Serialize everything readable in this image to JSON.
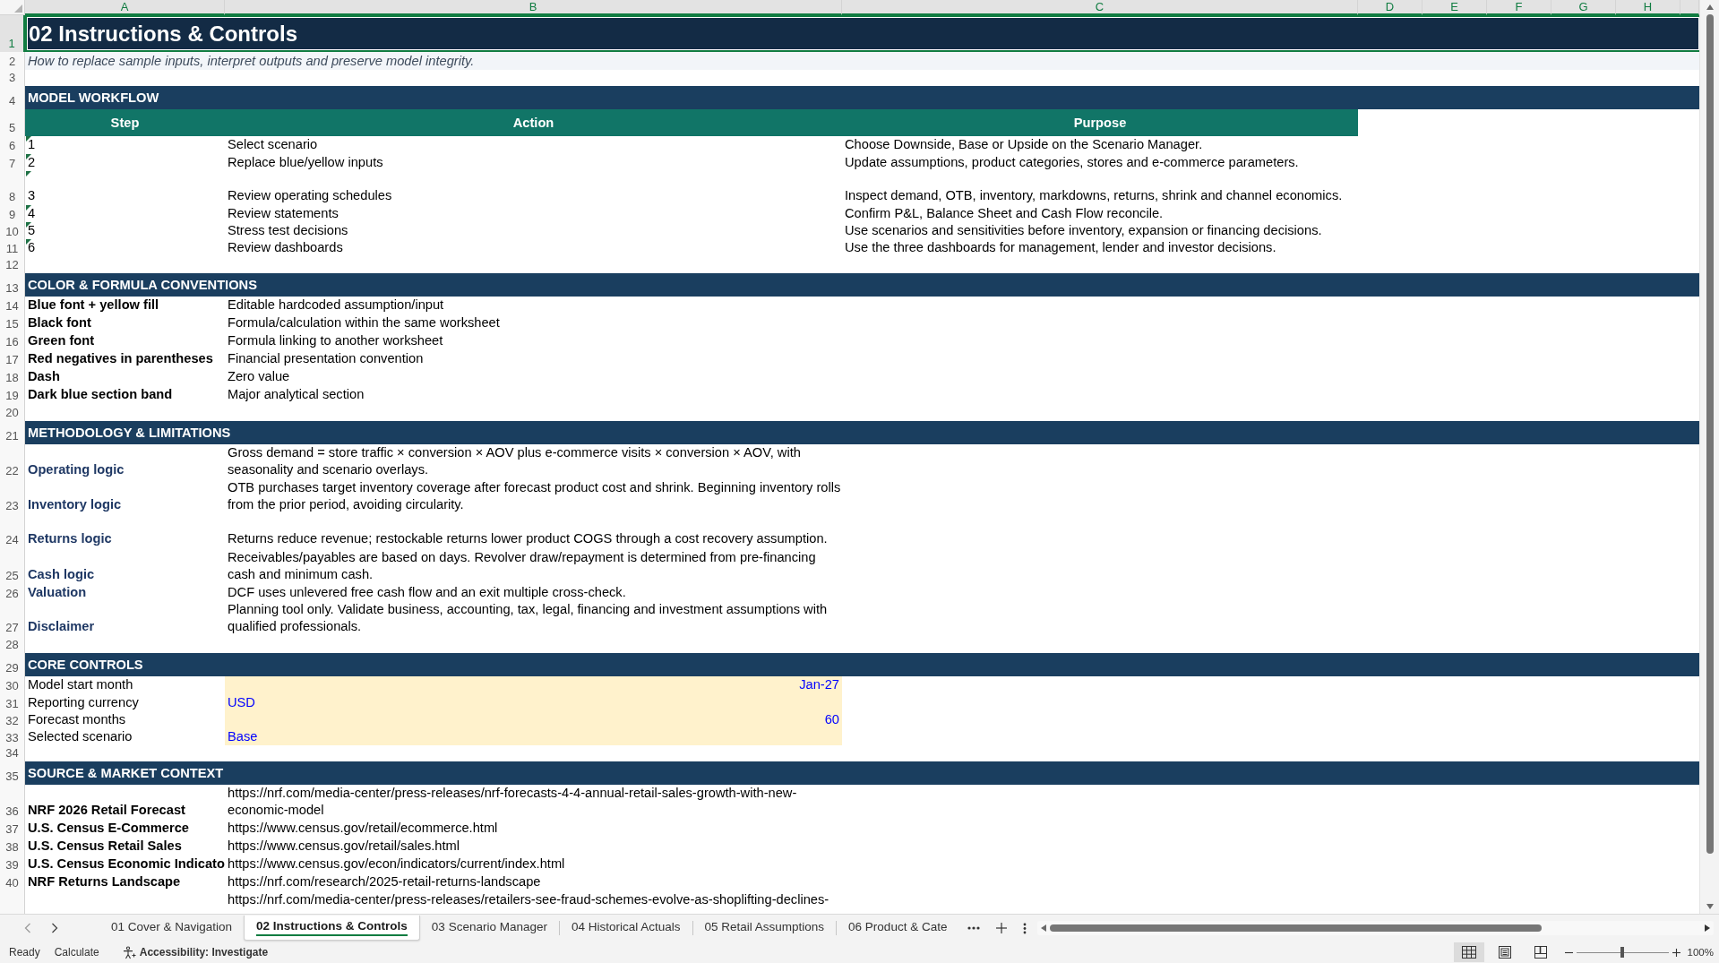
{
  "sheet": {
    "columns": [
      {
        "label": "A",
        "selected": true
      },
      {
        "label": "B",
        "selected": true
      },
      {
        "label": "C",
        "selected": true
      },
      {
        "label": "D",
        "selected": true
      },
      {
        "label": "E",
        "selected": true
      },
      {
        "label": "F",
        "selected": true
      },
      {
        "label": "G",
        "selected": true
      },
      {
        "label": "H",
        "selected": true
      }
    ],
    "rows": [
      {
        "row": "1",
        "kind": "title",
        "text": "02 Instructions & Controls",
        "selected": true
      },
      {
        "row": "2",
        "kind": "subtitle",
        "text": "How to replace sample inputs, interpret outputs and preserve model integrity."
      },
      {
        "row": "3",
        "kind": "blank"
      },
      {
        "row": "4",
        "kind": "section",
        "text": "MODEL WORKFLOW"
      },
      {
        "row": "5",
        "kind": "table_header",
        "cells": [
          "Step",
          "Action",
          "Purpose"
        ]
      },
      {
        "row": "6",
        "kind": "step",
        "flagged": true,
        "cells": [
          "1",
          "Select scenario",
          "Choose Downside, Base or Upside on the Scenario Manager."
        ]
      },
      {
        "row": "7",
        "kind": "step",
        "flagged": true,
        "cells": [
          "2",
          "Replace blue/yellow inputs",
          "Update assumptions, product categories, stores and e-commerce parameters."
        ]
      },
      {
        "row": "8",
        "kind": "step",
        "flagged": true,
        "cells": [
          "3",
          "Review operating schedules",
          "Inspect demand, OTB, inventory, markdowns, returns, shrink and channel economics."
        ]
      },
      {
        "row": "9",
        "kind": "step",
        "flagged": true,
        "cells": [
          "4",
          "Review statements",
          "Confirm P&L, Balance Sheet and Cash Flow reconcile."
        ]
      },
      {
        "row": "10",
        "kind": "step",
        "flagged": true,
        "cells": [
          "5",
          "Stress test decisions",
          "Use scenarios and sensitivities before inventory, expansion or financing decisions."
        ]
      },
      {
        "row": "11",
        "kind": "step",
        "flagged": true,
        "cells": [
          "6",
          "Review dashboards",
          "Use the three dashboards for management, lender and investor decisions."
        ]
      },
      {
        "row": "12",
        "kind": "blank"
      },
      {
        "row": "13",
        "kind": "section",
        "text": "COLOR & FORMULA CONVENTIONS"
      },
      {
        "row": "14",
        "kind": "convention",
        "label": "Blue font + yellow fill",
        "description": "Editable hardcoded assumption/input"
      },
      {
        "row": "15",
        "kind": "convention",
        "label": "Black font",
        "description": "Formula/calculation within the same worksheet"
      },
      {
        "row": "16",
        "kind": "convention",
        "label": "Green font",
        "description": "Formula linking to another worksheet"
      },
      {
        "row": "17",
        "kind": "convention",
        "label": "Red negatives in parentheses",
        "description": "Financial presentation convention"
      },
      {
        "row": "18",
        "kind": "convention",
        "label": "Dash",
        "description": "Zero value"
      },
      {
        "row": "19",
        "kind": "convention",
        "label": "Dark blue section band",
        "description": "Major analytical section"
      },
      {
        "row": "20",
        "kind": "blank"
      },
      {
        "row": "21",
        "kind": "section",
        "text": "METHODOLOGY & LIMITATIONS"
      },
      {
        "row": "22",
        "kind": "method",
        "label": "Operating logic",
        "description": "Gross demand = store traffic × conversion × AOV plus e-commerce visits × conversion × AOV, with seasonality and scenario overlays."
      },
      {
        "row": "23",
        "kind": "method",
        "label": "Inventory logic",
        "description": "OTB purchases target inventory coverage after forecast product cost and shrink. Beginning inventory rolls from the prior period, avoiding circularity."
      },
      {
        "row": "24",
        "kind": "method",
        "label": "Returns logic",
        "description": "Returns reduce revenue; restockable returns lower product COGS through a cost recovery assumption."
      },
      {
        "row": "25",
        "kind": "method",
        "label": "Cash logic",
        "description": "Receivables/payables are based on days. Revolver draw/repayment is determined from pre-financing cash and minimum cash."
      },
      {
        "row": "26",
        "kind": "method",
        "label": "Valuation",
        "description": "DCF uses unlevered free cash flow and an exit multiple cross-check."
      },
      {
        "row": "27",
        "kind": "method",
        "label": "Disclaimer",
        "description": "Planning tool only. Validate business, accounting, tax, legal, financing and investment assumptions with qualified professionals."
      },
      {
        "row": "28",
        "kind": "blank"
      },
      {
        "row": "29",
        "kind": "section",
        "text": "CORE CONTROLS"
      },
      {
        "row": "30",
        "kind": "date_input",
        "label": "Model start month",
        "value": "Jan-27"
      },
      {
        "row": "31",
        "kind": "text_input",
        "label": "Reporting currency",
        "value": "USD"
      },
      {
        "row": "32",
        "kind": "number_input",
        "label": "Forecast months",
        "value": "60"
      },
      {
        "row": "33",
        "kind": "text_input",
        "label": "Selected scenario",
        "value": "Base"
      },
      {
        "row": "34",
        "kind": "blank"
      },
      {
        "row": "35",
        "kind": "section",
        "text": "SOURCE & MARKET CONTEXT"
      },
      {
        "row": "36",
        "kind": "source",
        "label": "NRF 2026 Retail Forecast",
        "url": "https://nrf.com/media-center/press-releases/nrf-forecasts-4-4-annual-retail-sales-growth-with-new-economic-model"
      },
      {
        "row": "37",
        "kind": "source",
        "label": "U.S. Census E-Commerce",
        "url": "https://www.census.gov/retail/ecommerce.html"
      },
      {
        "row": "38",
        "kind": "source",
        "label": "U.S. Census Retail Sales",
        "url": "https://www.census.gov/retail/sales.html"
      },
      {
        "row": "39",
        "kind": "source",
        "label": "U.S. Census Economic Indicato",
        "url": "https://www.census.gov/econ/indicators/current/index.html"
      },
      {
        "row": "40",
        "kind": "source",
        "label": "NRF Returns Landscape",
        "url": "https://nrf.com/research/2025-retail-returns-landscape"
      },
      {
        "kind": "source",
        "url": "https://nrf.com/media-center/press-releases/retailers-see-fraud-schemes-evolve-as-shoplifting-declines-"
      }
    ]
  },
  "sheet_tabs": [
    {
      "label": "01 Cover & Navigation",
      "selected": false
    },
    {
      "label": "02 Instructions & Controls",
      "selected": true
    },
    {
      "label": "03 Scenario Manager",
      "selected": false
    },
    {
      "label": "04 Historical Actuals",
      "selected": false
    },
    {
      "label": "05 Retail Assumptions",
      "selected": false
    },
    {
      "label": "06 Product & Cate",
      "selected": false
    }
  ],
  "status_bar": {
    "mode": "Ready",
    "calculate": "Calculate",
    "accessibility": "Accessibility: Investigate",
    "views": [
      {
        "kind": "normal",
        "selected": true
      },
      {
        "kind": "page_layout",
        "selected": false
      },
      {
        "kind": "page_break",
        "selected": false
      }
    ],
    "zoom": {
      "level": 0.5,
      "reading": "100%"
    }
  }
}
